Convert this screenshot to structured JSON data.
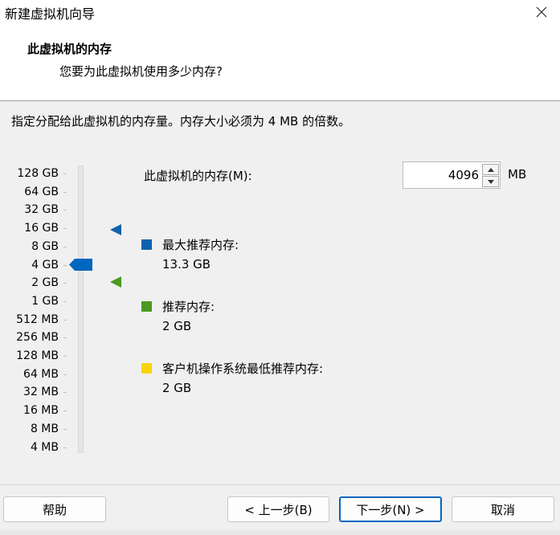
{
  "window": {
    "title": "新建虚拟机向导"
  },
  "header": {
    "title": "此虚拟机的内存",
    "subtitle": "您要为此虚拟机使用多少内存?"
  },
  "instruction": "指定分配给此虚拟机的内存量。内存大小必须为 4 MB 的倍数。",
  "slider": {
    "labels": [
      "128 GB",
      "64 GB",
      "32 GB",
      "16 GB",
      "8 GB",
      "4 GB",
      "2 GB",
      "1 GB",
      "512 MB",
      "256 MB",
      "128 MB",
      "64 MB",
      "32 MB",
      "16 MB",
      "8 MB",
      "4 MB"
    ],
    "selected_label": "4 GB",
    "max_recommended_label": "16 GB",
    "recommended_label": "2 GB"
  },
  "memory": {
    "label": "此虚拟机的内存(M):",
    "value": "4096",
    "unit": "MB"
  },
  "legend": [
    {
      "title": "最大推荐内存:",
      "value": "13.3 GB",
      "color": "#0f62ad"
    },
    {
      "title": "推荐内存:",
      "value": "2 GB",
      "color": "#4b9a1f"
    },
    {
      "title": "客户机操作系统最低推荐内存:",
      "value": "2 GB",
      "color": "#f7d40a"
    }
  ],
  "buttons": {
    "help": "帮助",
    "back": "< 上一步(B)",
    "next": "下一步(N) >",
    "cancel": "取消"
  },
  "colors": {
    "accent": "#0067c0",
    "max_marker": "#0f62ad",
    "recommended_marker": "#4b9a1f"
  }
}
